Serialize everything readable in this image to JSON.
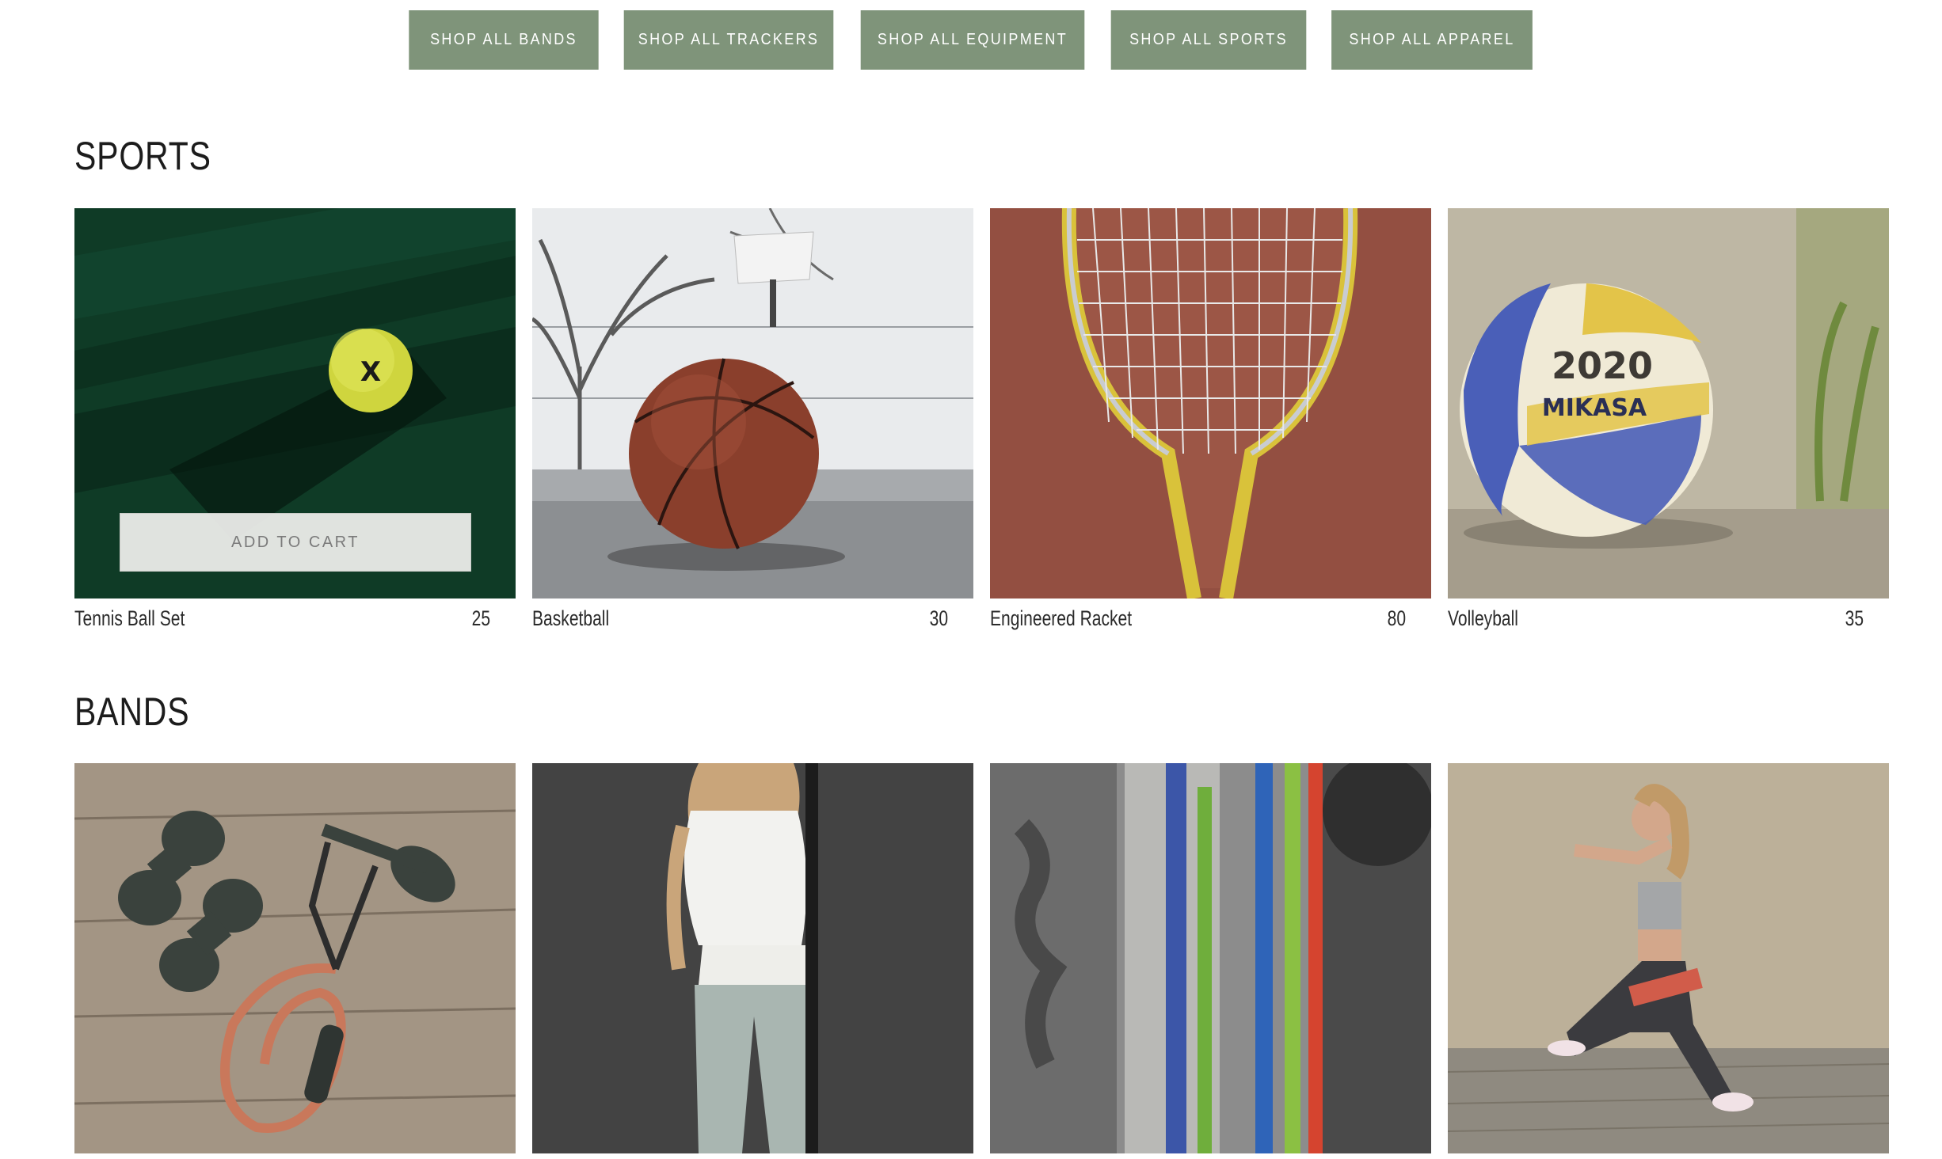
{
  "nav": {
    "buttons": [
      "SHOP ALL BANDS",
      "SHOP ALL TRACKERS",
      "SHOP ALL EQUIPMENT",
      "SHOP ALL SPORTS",
      "SHOP ALL APPAREL"
    ]
  },
  "sections": {
    "sports": {
      "title": "SPORTS",
      "add_to_cart": "ADD TO CART",
      "products": [
        {
          "name": "Tennis Ball Set",
          "price": "25",
          "image": "tennis-ball-photo"
        },
        {
          "name": "Basketball",
          "price": "30",
          "image": "basketball-photo"
        },
        {
          "name": "Engineered Racket",
          "price": "80",
          "image": "tennis-racket-photo"
        },
        {
          "name": "Volleyball",
          "price": "35",
          "image": "volleyball-photo"
        }
      ]
    },
    "bands": {
      "title": "BANDS",
      "products": [
        {
          "image": "dumbbells-and-resistance-band-photo"
        },
        {
          "image": "woman-holding-band-photo"
        },
        {
          "image": "hanging-colored-bands-photo"
        },
        {
          "image": "woman-squat-with-band-photo"
        }
      ]
    }
  },
  "colors": {
    "nav_button": "#7f947a",
    "nav_text": "#ffffff",
    "heading": "#1c1c1c"
  }
}
